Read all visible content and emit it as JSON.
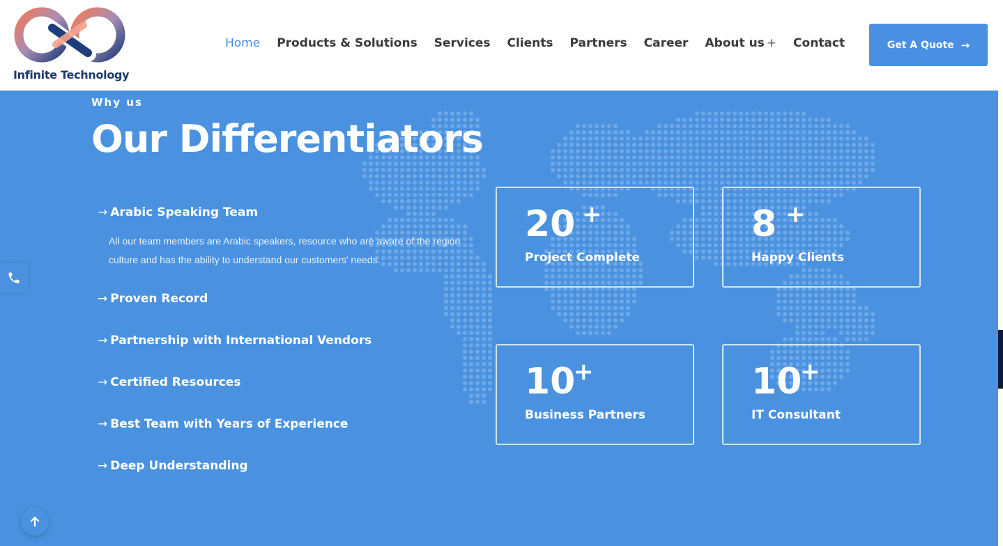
{
  "brand": {
    "name": "Infinite Technology"
  },
  "nav": {
    "items": [
      {
        "label": "Home",
        "active": true,
        "has_submenu": false
      },
      {
        "label": "Products & Solutions",
        "active": false,
        "has_submenu": false
      },
      {
        "label": "Services",
        "active": false,
        "has_submenu": false
      },
      {
        "label": "Clients",
        "active": false,
        "has_submenu": false
      },
      {
        "label": "Partners",
        "active": false,
        "has_submenu": false
      },
      {
        "label": "Career",
        "active": false,
        "has_submenu": false
      },
      {
        "label": "About us",
        "active": false,
        "has_submenu": true
      },
      {
        "label": "Contact",
        "active": false,
        "has_submenu": false
      }
    ],
    "submenu_symbol": "+",
    "cta_label": "Get A Quote",
    "cta_arrow": "→"
  },
  "section": {
    "eyebrow": "Why us",
    "title": "Our Differentiators",
    "arrow": "→",
    "features": [
      {
        "title": "Arabic Speaking Team",
        "description": "All our team members are Arabic speakers, resource who are aware of the region culture and has the ability to understand our customers' needs."
      },
      {
        "title": "Proven Record"
      },
      {
        "title": "Partnership with International Vendors"
      },
      {
        "title": "Certified Resources"
      },
      {
        "title": "Best Team with Years of Experience"
      },
      {
        "title": "Deep Understanding"
      }
    ],
    "stats": [
      {
        "value": "20",
        "suffix": "+",
        "label": "Project Complete"
      },
      {
        "value": "8",
        "suffix": "+",
        "label": "Happy Clients"
      },
      {
        "value": "10",
        "suffix": "+",
        "label": "Business Partners"
      },
      {
        "value": "10",
        "suffix": "+",
        "label": "IT Consultant"
      }
    ]
  },
  "colors": {
    "primary": "#4a92df",
    "button": "#4a90e2",
    "nav_active": "#4a90d9",
    "brand_text": "#1e3a6b",
    "logo_gradient_start": "#f07a5a",
    "logo_gradient_end": "#1f3d7a"
  },
  "icons": {
    "phone": "phone-icon",
    "scroll_top": "arrow-up-icon",
    "cta": "arrow-right-icon"
  }
}
